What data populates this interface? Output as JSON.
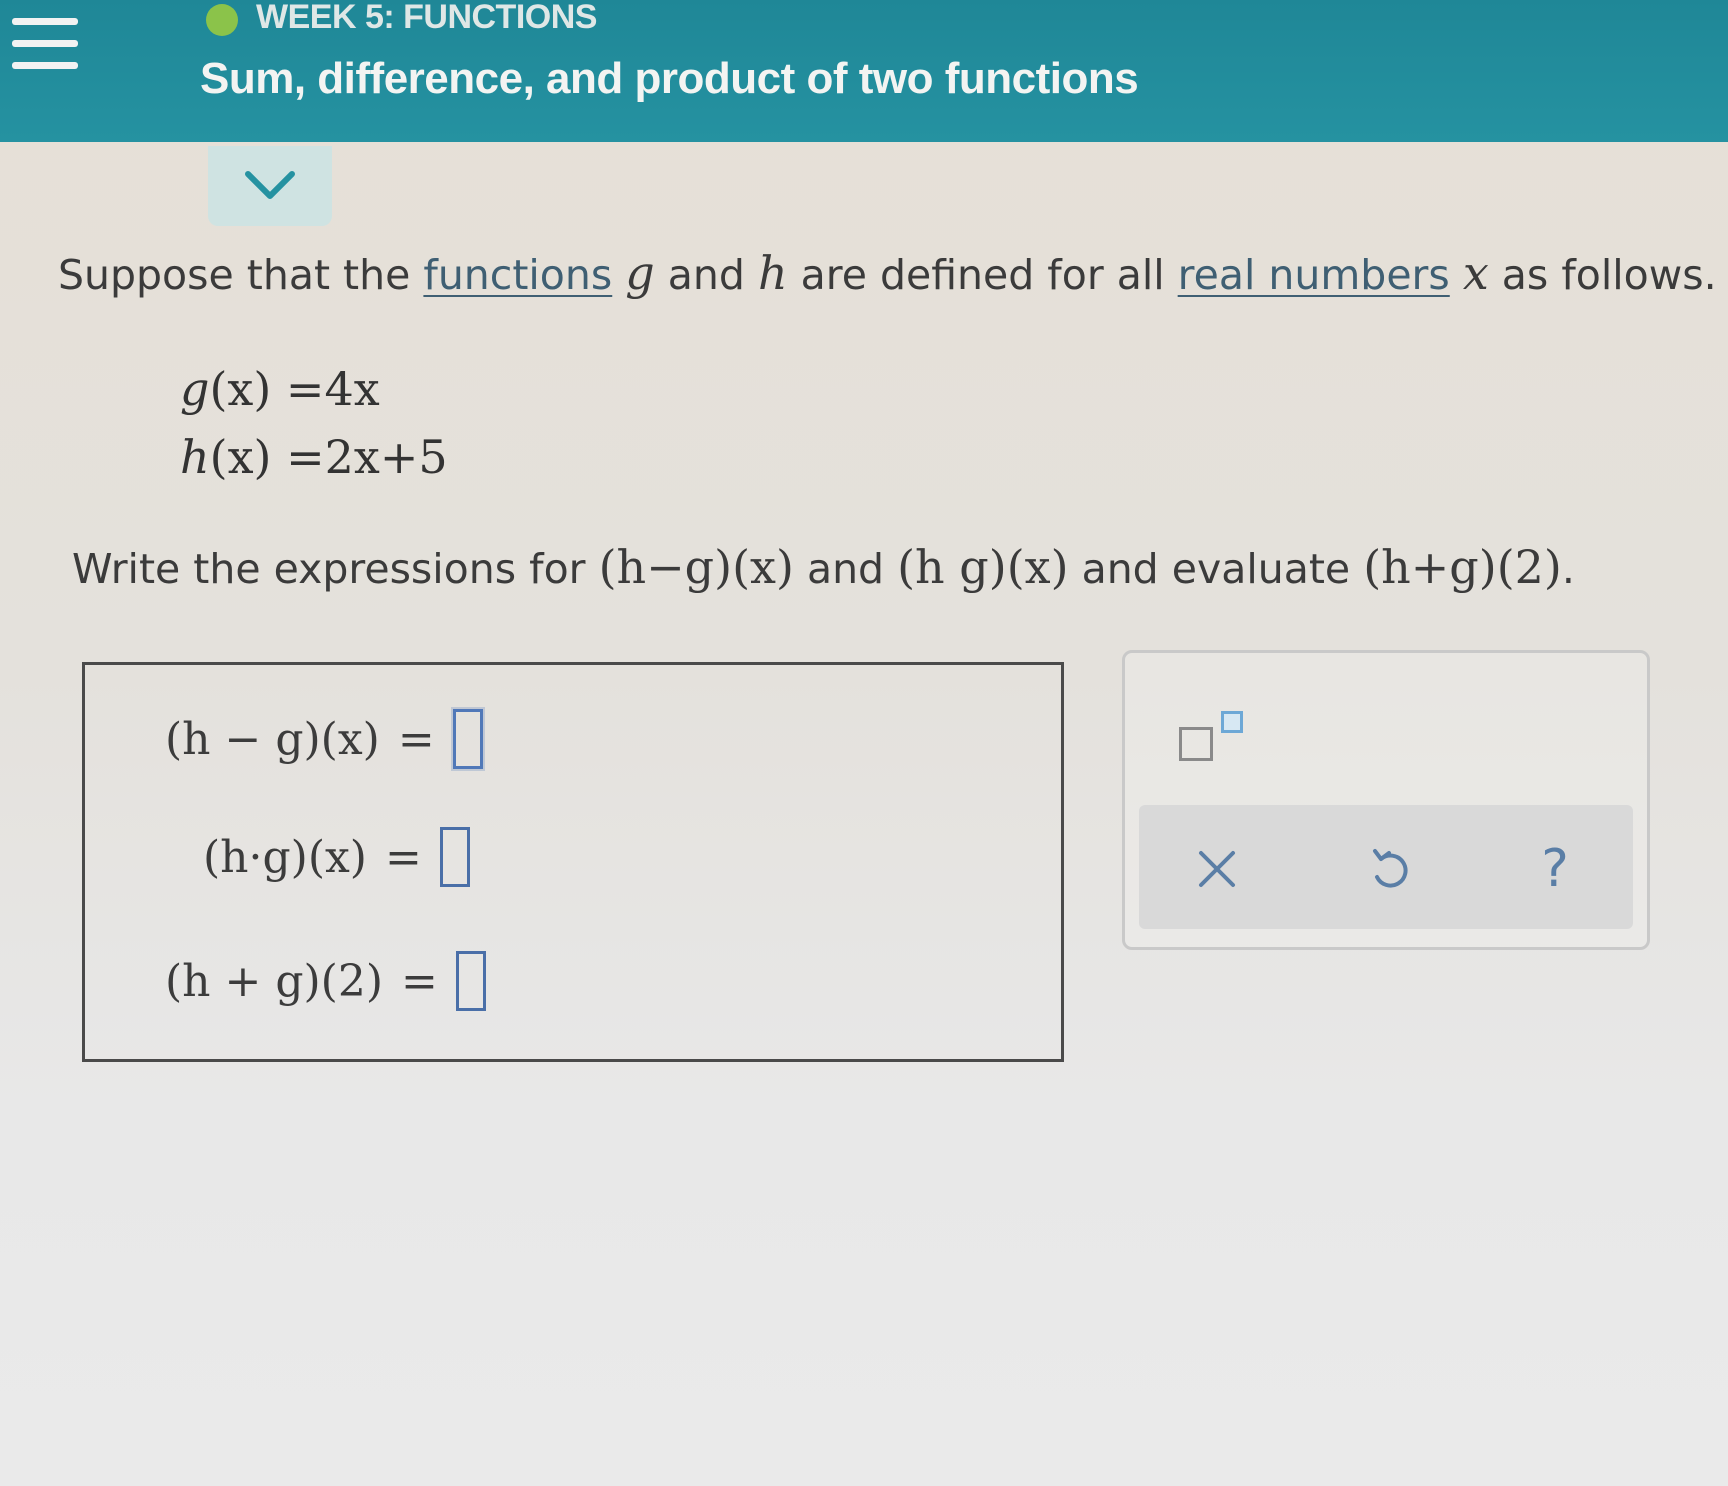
{
  "header": {
    "section_label": "WEEK 5: FUNCTIONS",
    "title": "Sum, difference, and product of two functions",
    "status_color": "#8bc34a",
    "background_color": "#2592a1"
  },
  "problem": {
    "prompt_start": "Suppose that the ",
    "link_functions": "functions",
    "var_g": "g",
    "and_word": " and ",
    "var_h": "h",
    "prompt_middle": " are defined for all ",
    "link_real_numbers": "real numbers",
    "var_x": "x",
    "prompt_end": " as follows.",
    "definitions": [
      {
        "name": "g",
        "arg": "(x)",
        "rhs": "=4x"
      },
      {
        "name": "h",
        "arg": "(x)",
        "rhs": "=2x+5"
      }
    ],
    "instruction_start": "Write the expressions for ",
    "expr_difference": "(h−g)(x)",
    "instruction_and": " and ",
    "expr_product": "(h g)(x)",
    "instruction_evaluate": " and evaluate ",
    "expr_sum_at_2": "(h+g)(2)",
    "instruction_end": "."
  },
  "answers": [
    {
      "label": "(h − g)(x)",
      "equals": "=",
      "value": ""
    },
    {
      "label": "(h·g)(x)",
      "equals": "=",
      "value": ""
    },
    {
      "label": "(h + g)(2)",
      "equals": "=",
      "value": ""
    }
  ],
  "toolbar": {
    "exponent_icon": "superscript-template-icon",
    "clear_icon": "close-icon",
    "undo_icon": "undo-icon",
    "help_label": "?"
  }
}
